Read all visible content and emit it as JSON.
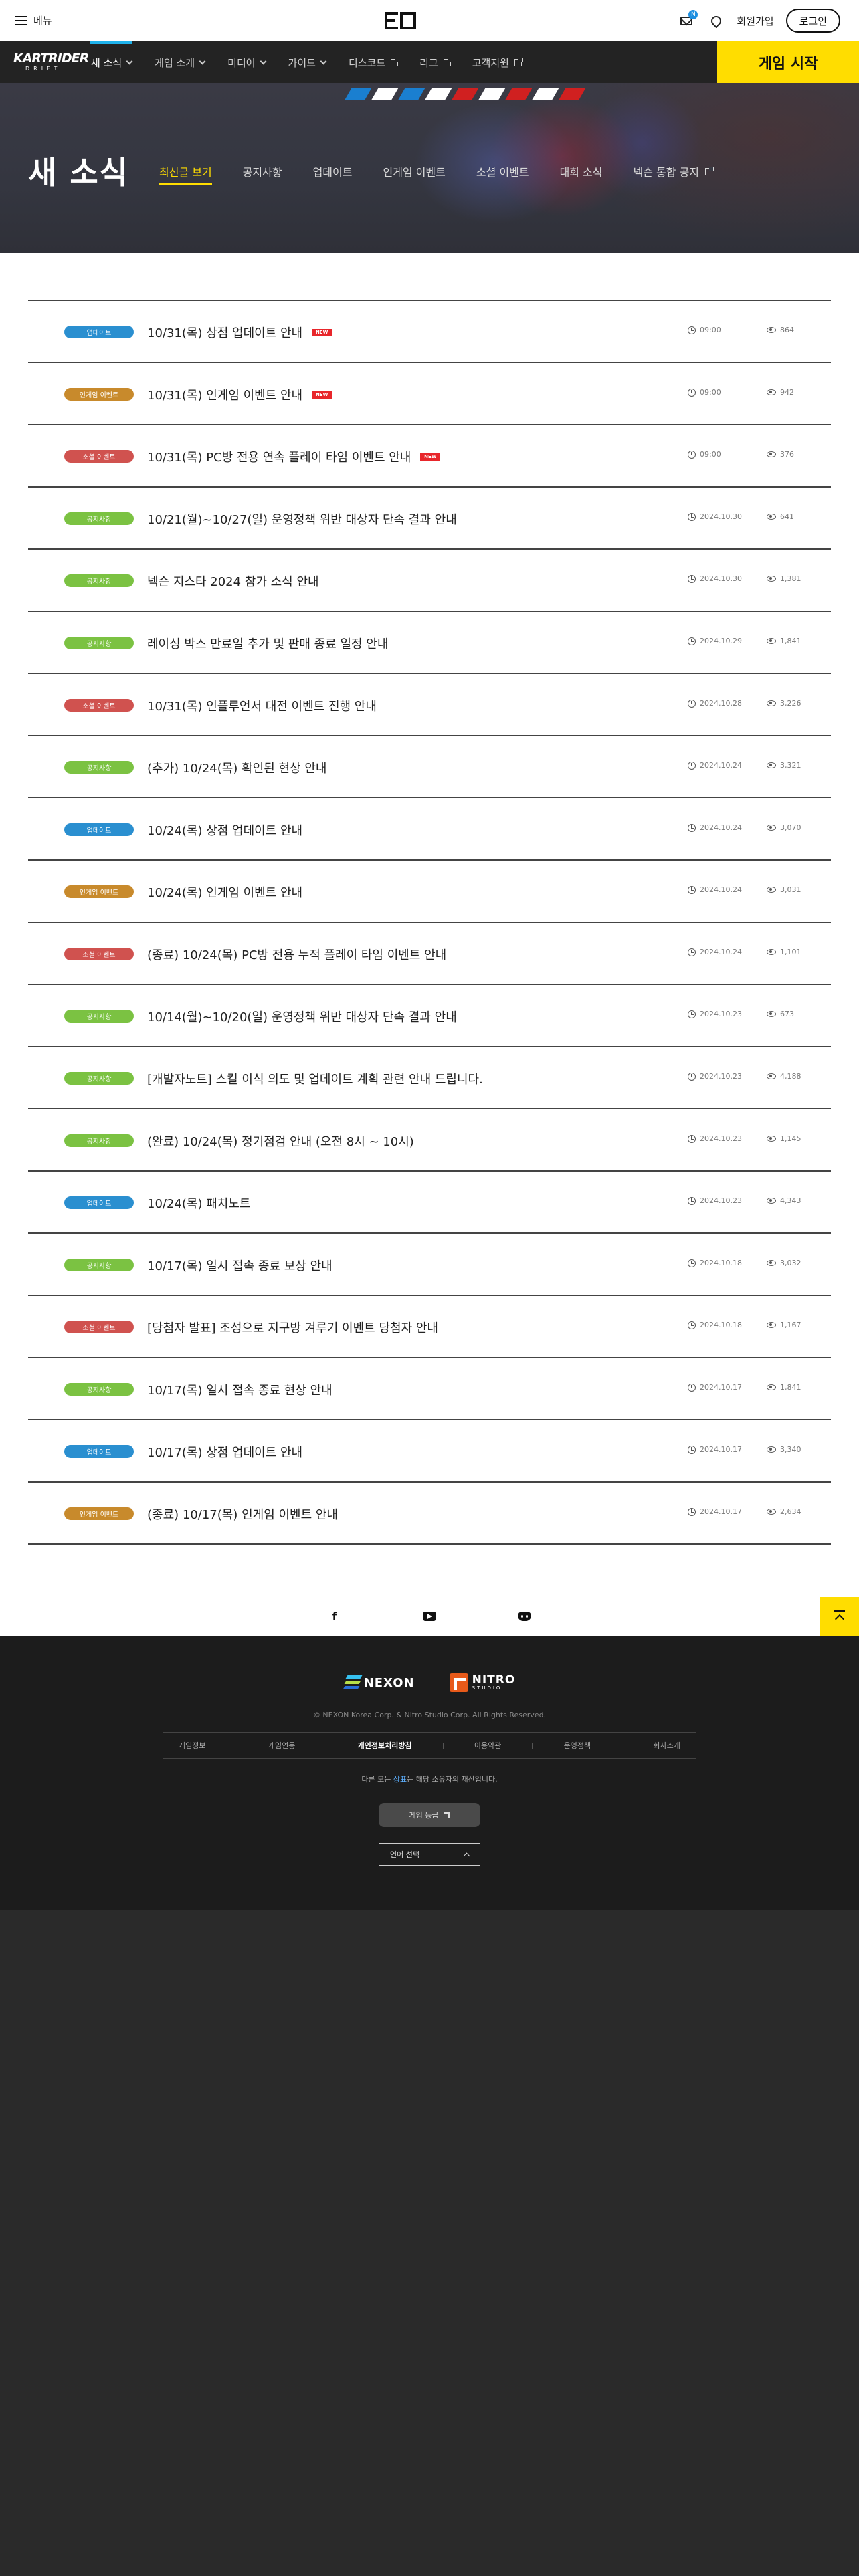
{
  "topbar": {
    "menu_label": "메뉴",
    "mail_badge": "N",
    "signup_label": "회원가입",
    "login_label": "로그인"
  },
  "nav": {
    "brand_line1": "KARTRIDER",
    "brand_line2": "DRIFT",
    "items": [
      {
        "label": "새 소식"
      },
      {
        "label": "게임 소개"
      },
      {
        "label": "미디어"
      },
      {
        "label": "가이드"
      },
      {
        "label": "디스코드"
      },
      {
        "label": "리그"
      },
      {
        "label": "고객지원"
      }
    ],
    "start_label": "게임 시작"
  },
  "hero": {
    "title": "새 소식",
    "tabs": [
      {
        "label": "최신글 보기"
      },
      {
        "label": "공지사항"
      },
      {
        "label": "업데이트"
      },
      {
        "label": "인게임 이벤트"
      },
      {
        "label": "소셜 이벤트"
      },
      {
        "label": "대회 소식"
      },
      {
        "label": "넥슨 통합 공지"
      }
    ]
  },
  "posts": [
    {
      "category": "업데이트",
      "color": "#2a8fd0",
      "title": "10/31(목) 상점 업데이트 안내",
      "new": "NEW",
      "date": "09:00",
      "views": "864"
    },
    {
      "category": "인게임 이벤트",
      "color": "#c88a2c",
      "title": "10/31(목) 인게임 이벤트 안내",
      "new": "NEW",
      "date": "09:00",
      "views": "942"
    },
    {
      "category": "소셜 이벤트",
      "color": "#d0524f",
      "title": "10/31(목) PC방 전용 연속 플레이 타임 이벤트 안내",
      "new": "NEW",
      "date": "09:00",
      "views": "376"
    },
    {
      "category": "공지사항",
      "color": "#7bc242",
      "title": "10/21(월)~10/27(일) 운영정책 위반 대상자 단속 결과 안내",
      "new": "",
      "date": "2024.10.30",
      "views": "641"
    },
    {
      "category": "공지사항",
      "color": "#7bc242",
      "title": "넥슨 지스타 2024 참가 소식 안내",
      "new": "",
      "date": "2024.10.30",
      "views": "1,381"
    },
    {
      "category": "공지사항",
      "color": "#7bc242",
      "title": "레이싱 박스 만료일 추가 및 판매 종료 일정 안내",
      "new": "",
      "date": "2024.10.29",
      "views": "1,841"
    },
    {
      "category": "소셜 이벤트",
      "color": "#d0524f",
      "title": "10/31(목) 인플루언서 대전 이벤트 진행 안내",
      "new": "",
      "date": "2024.10.28",
      "views": "3,226"
    },
    {
      "category": "공지사항",
      "color": "#7bc242",
      "title": "(추가) 10/24(목) 확인된 현상 안내",
      "new": "",
      "date": "2024.10.24",
      "views": "3,321"
    },
    {
      "category": "업데이트",
      "color": "#2a8fd0",
      "title": "10/24(목) 상점 업데이트 안내",
      "new": "",
      "date": "2024.10.24",
      "views": "3,070"
    },
    {
      "category": "인게임 이벤트",
      "color": "#c88a2c",
      "title": "10/24(목) 인게임 이벤트 안내",
      "new": "",
      "date": "2024.10.24",
      "views": "3,031"
    },
    {
      "category": "소셜 이벤트",
      "color": "#d0524f",
      "title": "(종료) 10/24(목) PC방 전용 누적 플레이 타임 이벤트 안내",
      "new": "",
      "date": "2024.10.24",
      "views": "1,101"
    },
    {
      "category": "공지사항",
      "color": "#7bc242",
      "title": "10/14(월)~10/20(일) 운영정책 위반 대상자 단속 결과 안내",
      "new": "",
      "date": "2024.10.23",
      "views": "673"
    },
    {
      "category": "공지사항",
      "color": "#7bc242",
      "title": "[개발자노트] 스킬 이식 의도 및 업데이트 계획 관련 안내 드립니다.",
      "new": "",
      "date": "2024.10.23",
      "views": "4,188"
    },
    {
      "category": "공지사항",
      "color": "#7bc242",
      "title": "(완료) 10/24(목) 정기점검 안내 (오전 8시 ~ 10시)",
      "new": "",
      "date": "2024.10.23",
      "views": "1,145"
    },
    {
      "category": "업데이트",
      "color": "#2a8fd0",
      "title": "10/24(목) 패치노트",
      "new": "",
      "date": "2024.10.23",
      "views": "4,343"
    },
    {
      "category": "공지사항",
      "color": "#7bc242",
      "title": "10/17(목) 일시 접속 종료 보상 안내",
      "new": "",
      "date": "2024.10.18",
      "views": "3,032"
    },
    {
      "category": "소셜 이벤트",
      "color": "#d0524f",
      "title": "[당첨자 발표] 조성으로 지구방 겨루기 이벤트 당첨자 안내",
      "new": "",
      "date": "2024.10.18",
      "views": "1,167"
    },
    {
      "category": "공지사항",
      "color": "#7bc242",
      "title": "10/17(목) 일시 접속 종료 현상 안내",
      "new": "",
      "date": "2024.10.17",
      "views": "1,841"
    },
    {
      "category": "업데이트",
      "color": "#2a8fd0",
      "title": "10/17(목) 상점 업데이트 안내",
      "new": "",
      "date": "2024.10.17",
      "views": "3,340"
    },
    {
      "category": "인게임 이벤트",
      "color": "#c88a2c",
      "title": "(종료) 10/17(목) 인게임 이벤트 안내",
      "new": "",
      "date": "2024.10.17",
      "views": "2,634"
    }
  ],
  "social": {
    "facebook_glyph": "f"
  },
  "footer": {
    "nexon_label": "NEXON",
    "nitro_label": "NITRO",
    "nitro_sub": "STUDIO",
    "copyright": "© NEXON Korea Corp. & Nitro Studio Corp. All Rights Reserved.",
    "links": [
      {
        "label": "게임정보",
        "bold": false
      },
      {
        "label": "게임연동",
        "bold": false
      },
      {
        "label": "개인정보처리방침",
        "bold": true
      },
      {
        "label": "이용약관",
        "bold": false
      },
      {
        "label": "운영정책",
        "bold": false
      },
      {
        "label": "회사소개",
        "bold": false
      }
    ],
    "footnote_pre": "다른 모든 ",
    "footnote_hl": "상표",
    "footnote_post": "는 해당 소유자의 재산입니다.",
    "rating_label": "게임 등급",
    "lang_label": "언어 선택"
  }
}
